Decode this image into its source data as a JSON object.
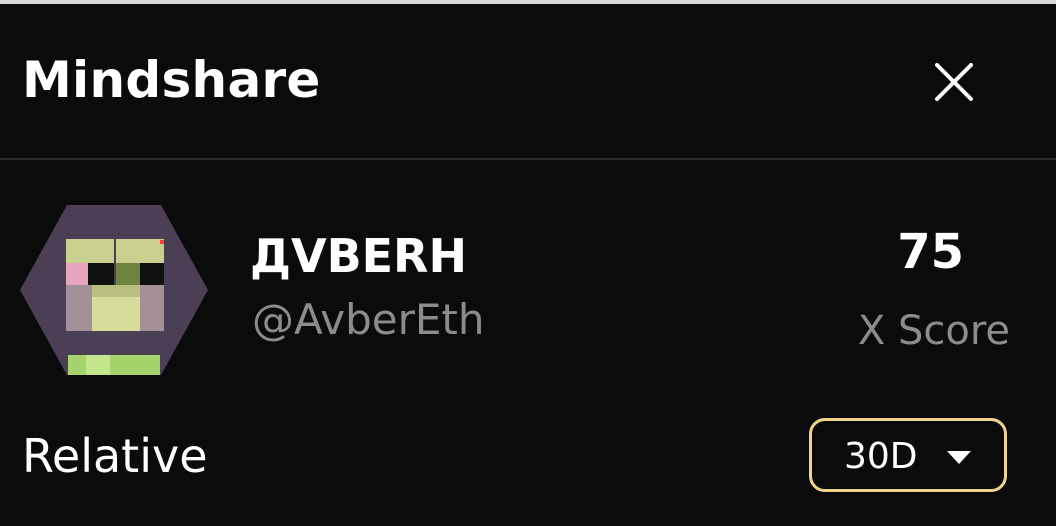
{
  "header": {
    "title": "Mindshare",
    "close_icon": "close-icon"
  },
  "profile": {
    "name": "ДVBERH",
    "handle": "@AvberEth",
    "avatar_icon": "pixel-art-frog-avatar"
  },
  "score": {
    "value": "75",
    "label": "X Score"
  },
  "relative": {
    "label": "Relative",
    "period_selected": "30D",
    "dropdown_icon": "caret-down-icon"
  },
  "colors": {
    "background": "#0b0b0c",
    "muted_text": "#8c8c90",
    "accent_border": "#f1d38a",
    "avatar_bg": "#4b3f55"
  }
}
